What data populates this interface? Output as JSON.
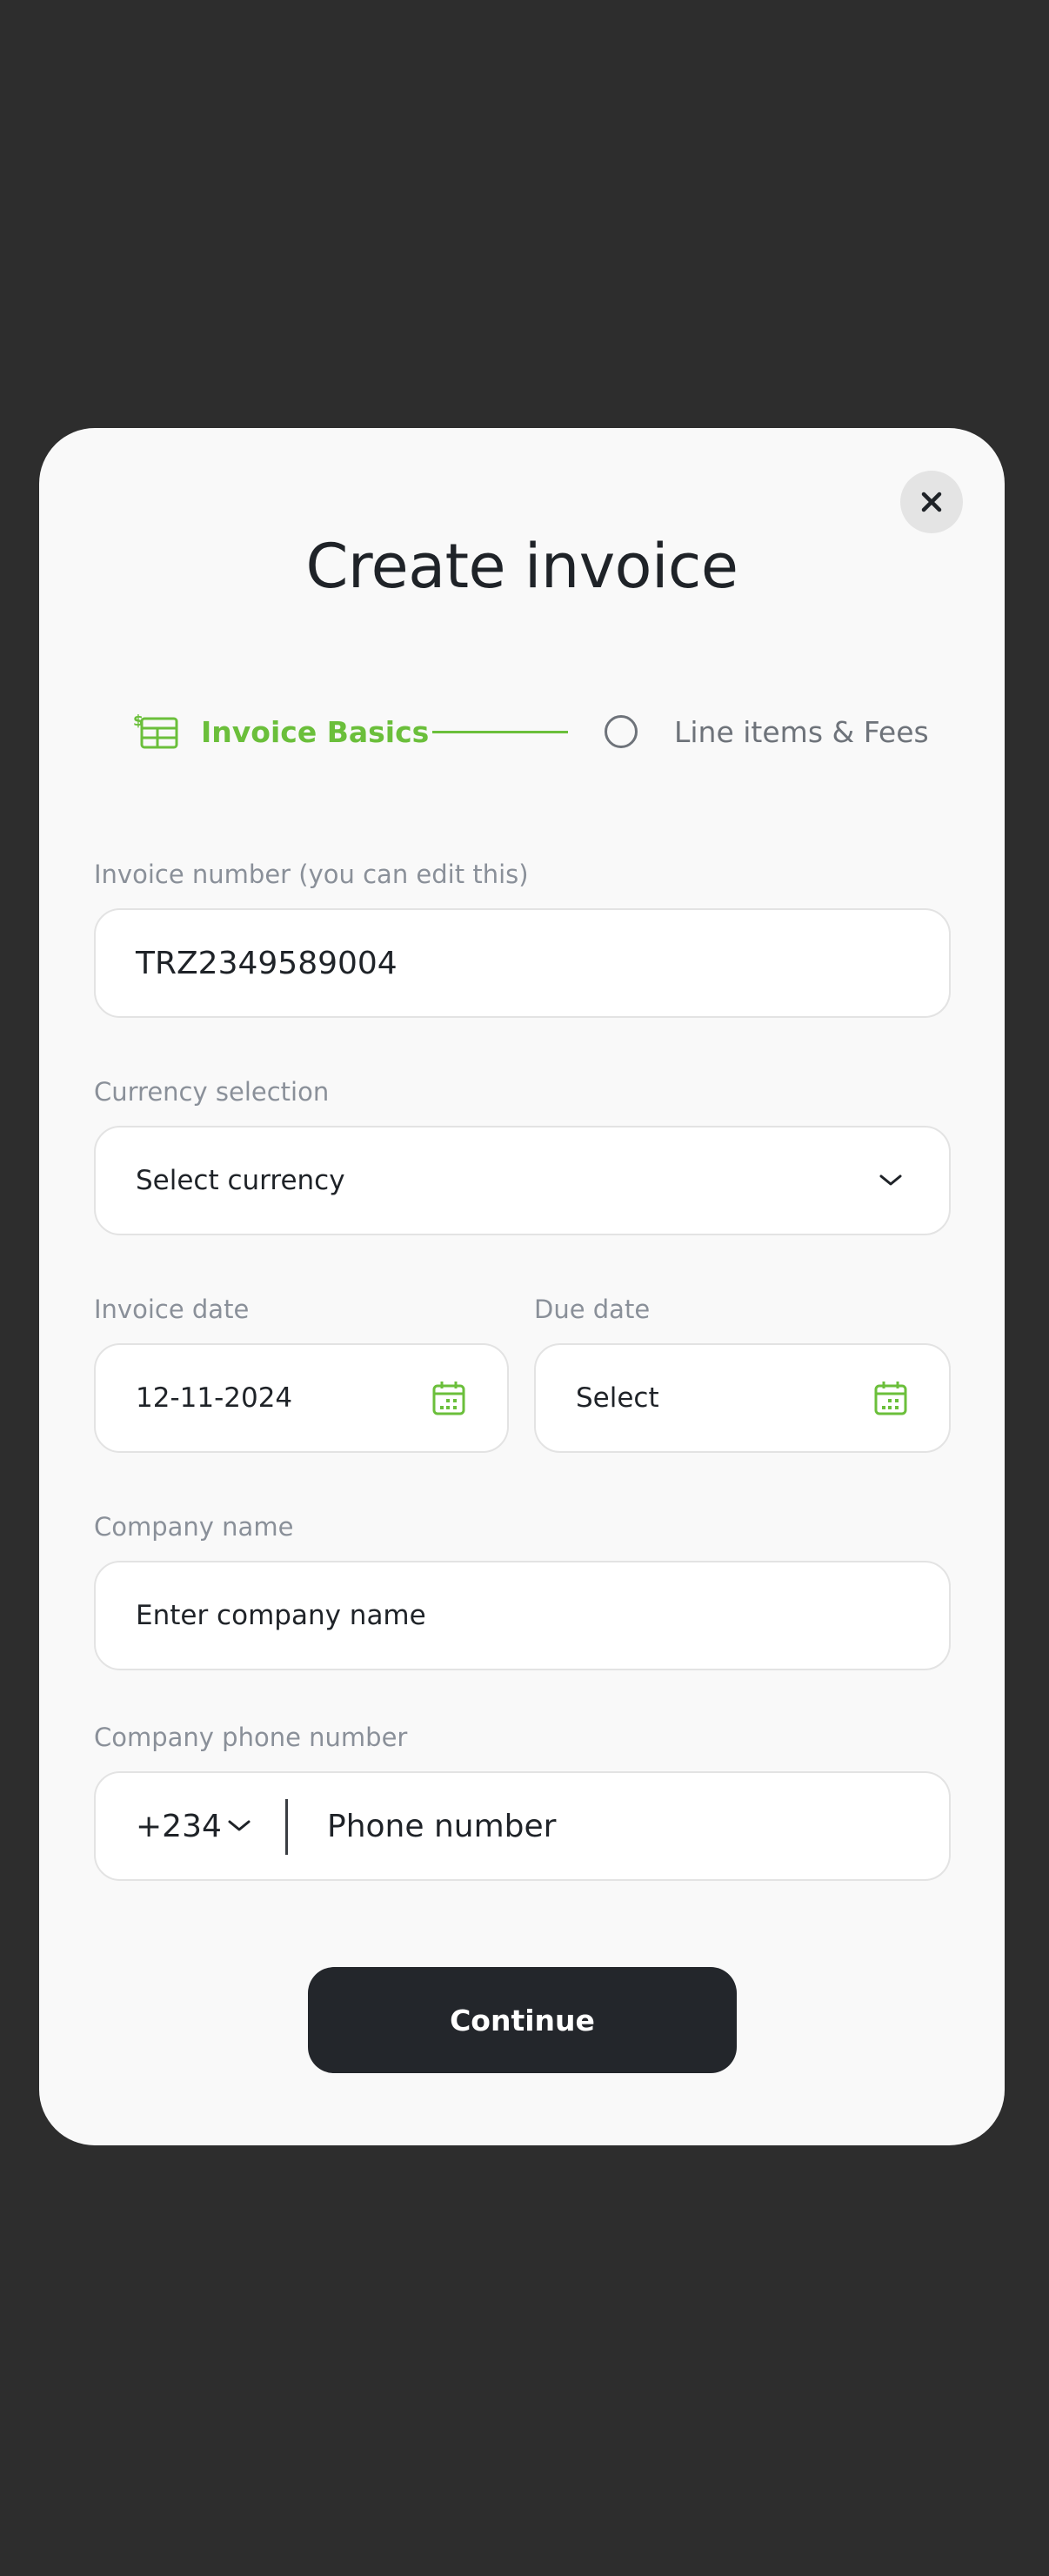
{
  "modal": {
    "title": "Create invoice",
    "close_icon": "close-icon"
  },
  "stepper": {
    "step1": {
      "label": "Invoice Basics",
      "icon": "invoice-icon",
      "state": "active"
    },
    "step2": {
      "label": "Line items & Fees",
      "state": "inactive"
    }
  },
  "form": {
    "invoice_number": {
      "label": "Invoice number (you can edit this)",
      "value": "TRZ2349589004"
    },
    "currency": {
      "label": "Currency selection",
      "value": "Select currency"
    },
    "invoice_date": {
      "label": "Invoice date",
      "value": "12-11-2024"
    },
    "due_date": {
      "label": "Due date",
      "value": "Select"
    },
    "company_name": {
      "label": "Company name",
      "placeholder": "Enter company name"
    },
    "company_phone": {
      "label": "Company phone number",
      "code": "+234",
      "placeholder": "Phone number"
    }
  },
  "actions": {
    "continue_label": "Continue"
  },
  "colors": {
    "accent": "#6bbf3b",
    "button": "#23262b",
    "backdrop": "#2d2d2d",
    "surface": "#f9f9f9"
  }
}
